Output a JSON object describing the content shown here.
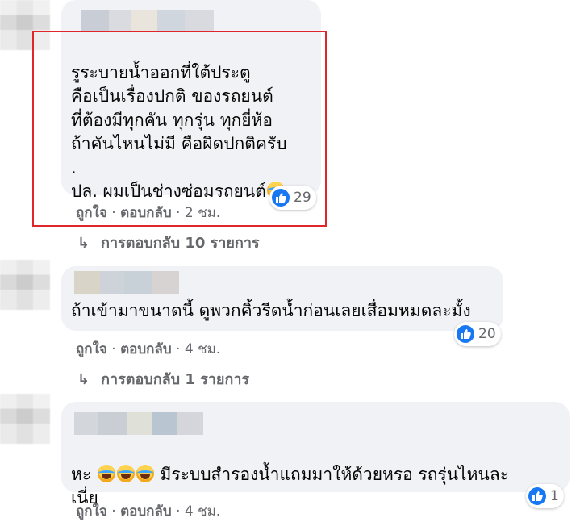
{
  "comments": [
    {
      "text": "รูระบายน้ำออกที่ใต้ประตู\nคือเป็นเรื่องปกติ ของรถยนต์\nที่ต้องมีทุกคัน ทุกรุ่น ทุกยี่ห้อ\nถ้าคันไหนไม่มี คือผิดปกติครับ\n.\nปล. ผมเป็นช่างซ่อมรถยนต์",
      "reaction_count": "29",
      "like_label": "ถูกใจ",
      "reply_label": "ตอบกลับ",
      "time": "2 ชม.",
      "replies_label": "การตอบกลับ 10 รายการ"
    },
    {
      "text": "ถ้าเข้ามาขนาดนี้ ดูพวกคิ้วรีดน้ำก่อนเลยเสื่อมหมดละมั้ง",
      "reaction_count": "20",
      "like_label": "ถูกใจ",
      "reply_label": "ตอบกลับ",
      "time": "4 ชม.",
      "replies_label": "การตอบกลับ 1 รายการ"
    },
    {
      "text_prefix": "หะ",
      "text_main": "มีระบบสำรองน้ำแถมมาให้ด้วยหรอ รถรุ่นไหนละ\nเนี่ย",
      "reaction_count": "1",
      "like_label": "ถูกใจ",
      "reply_label": "ตอบกลับ",
      "time": "4 ชม."
    }
  ],
  "separator": "·",
  "colors": {
    "bubble": "#f0f2f5",
    "meta_text": "#65676b",
    "like_blue": "#1877f2",
    "highlight_border": "#e0262b"
  }
}
